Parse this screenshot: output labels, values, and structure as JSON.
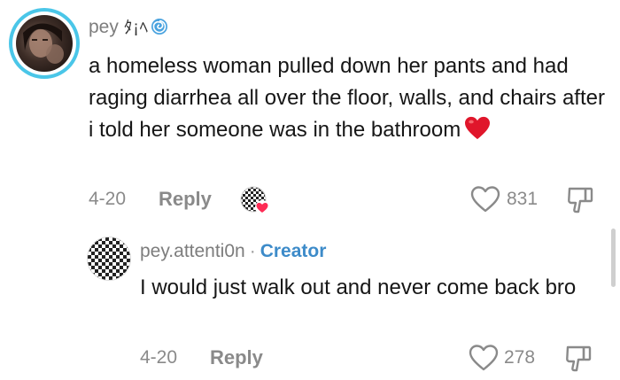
{
  "comment": {
    "username": "pey",
    "username_decoration": "ﾀ¡ﾍ",
    "text": "a homeless woman pulled down her pants and had raging diarrhea all over the floor, walls, and chairs after i told her someone was in the bathroom",
    "heart_emoji_icon": "red-heart-emoji",
    "date": "4-20",
    "reply_label": "Reply",
    "like_count": "831",
    "creator_liked_icon": "creator-liked-heart-icon"
  },
  "reply": {
    "username": "pey.attenti0n",
    "separator": "·",
    "creator_label": "Creator",
    "text": "I would just walk out and never come back bro",
    "date": "4-20",
    "reply_label": "Reply",
    "like_count": "278"
  },
  "colors": {
    "avatar_ring": "#4ac6e8",
    "creator_label": "#3d8bc9",
    "secondary_text": "#8a8a8a",
    "primary_text": "#161616",
    "heart_emoji": "#e0162b",
    "creator_liked_badge": "#fe2c55"
  }
}
